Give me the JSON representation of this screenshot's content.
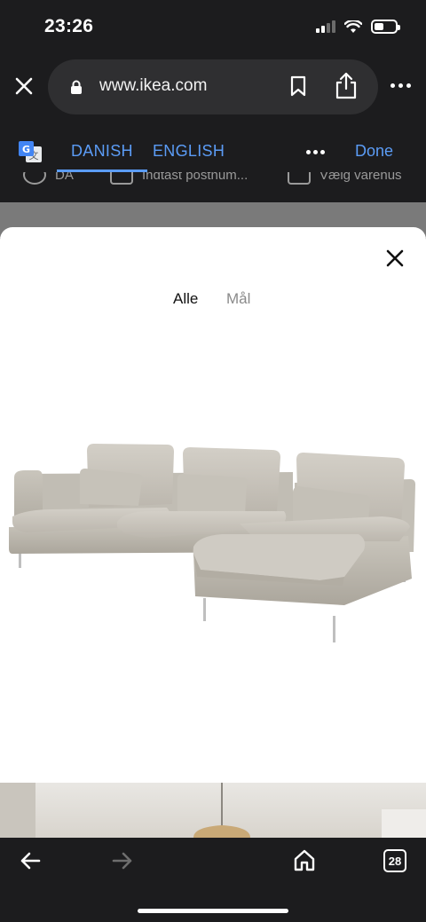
{
  "status_bar": {
    "time": "23:26"
  },
  "browser": {
    "url": "www.ikea.com",
    "tab_count": "28"
  },
  "translate_bar": {
    "lang_active": "DANISH",
    "lang_other": "ENGLISH",
    "done_label": "Done"
  },
  "ikea_strip": {
    "language": "DA",
    "postcode": "Indtast postnum...",
    "store": "Vælg varehus"
  },
  "sheet": {
    "tab_all": "Alle",
    "tab_dimensions": "Mål"
  },
  "colors": {
    "accent": "#5b9cf6",
    "chrome": "#1c1c1e",
    "sofa": "#c6c2b9"
  }
}
